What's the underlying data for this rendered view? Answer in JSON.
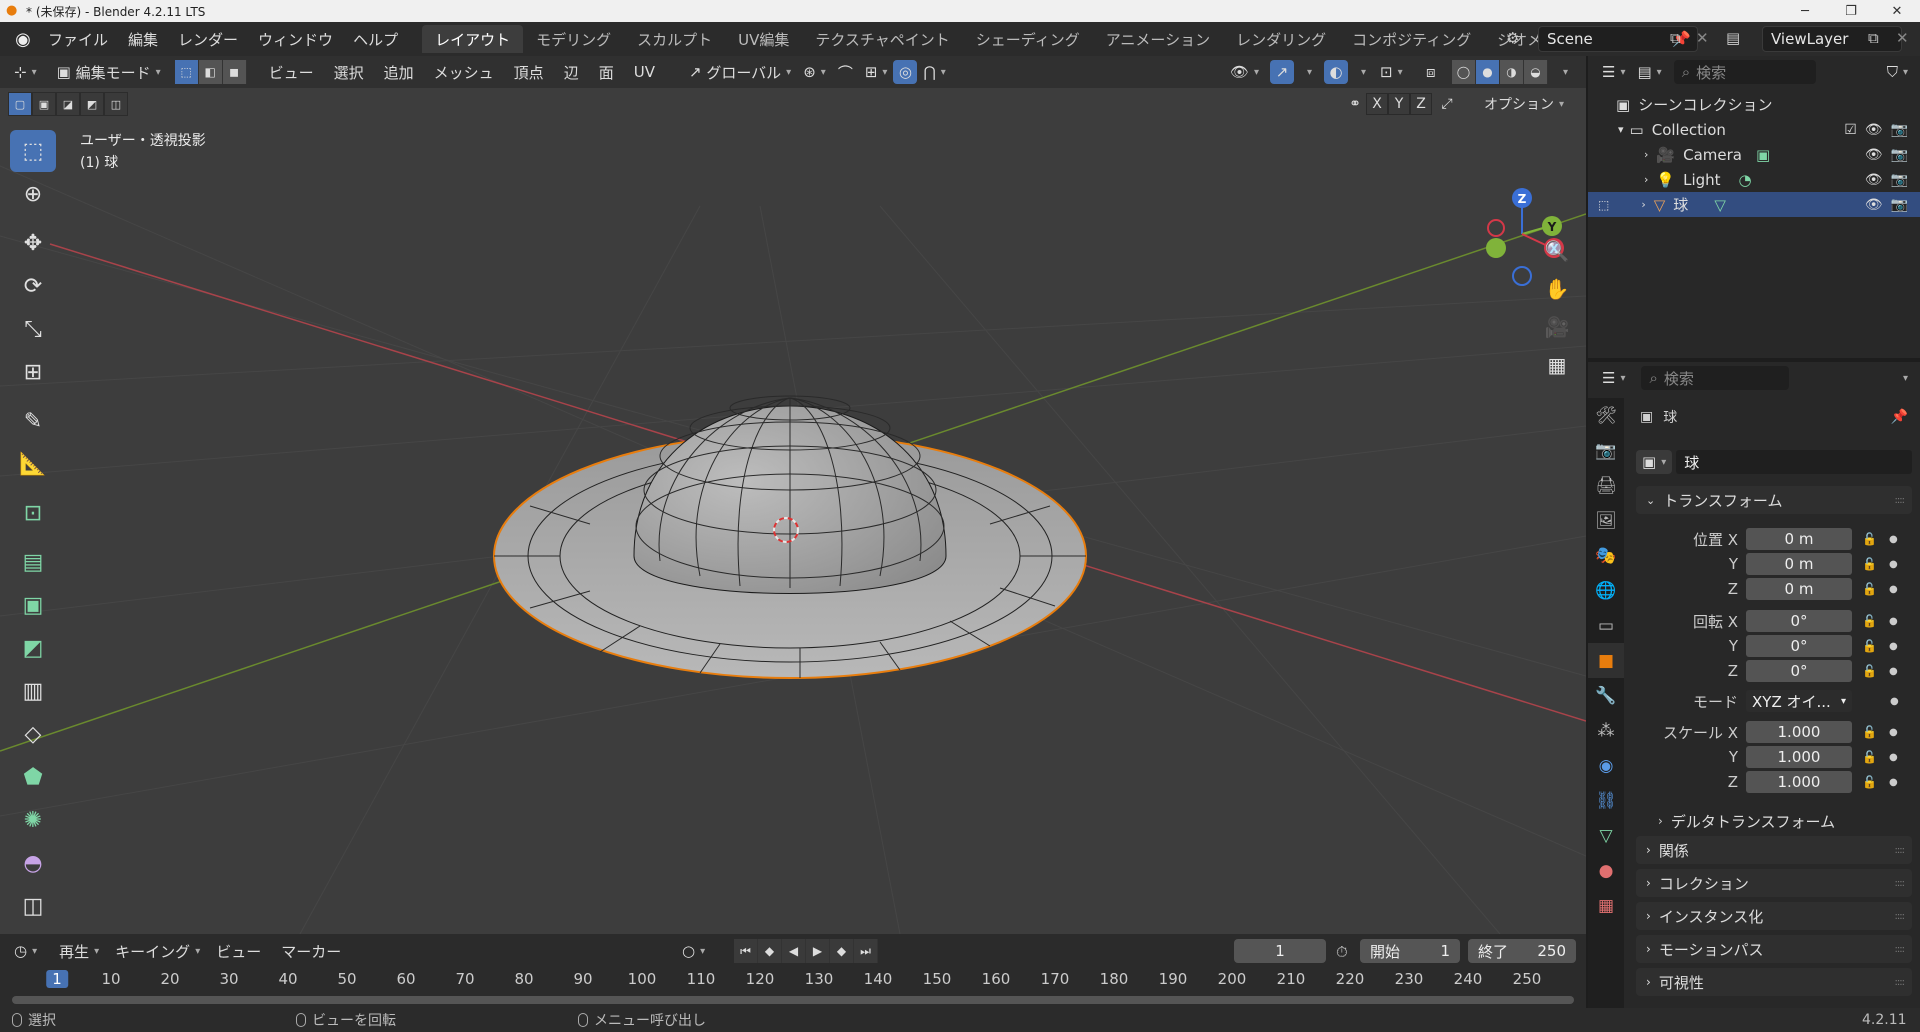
{
  "window": {
    "title": "* (未保存) - Blender 4.2.11 LTS"
  },
  "menu": [
    "ファイル",
    "編集",
    "レンダー",
    "ウィンドウ",
    "ヘルプ"
  ],
  "workspaces": [
    "レイアウト",
    "モデリング",
    "スカルプト",
    "UV編集",
    "テクスチャペイント",
    "シェーディング",
    "アニメーション",
    "レンダリング",
    "コンポジティング",
    "ジオメトリ"
  ],
  "scene": {
    "name": "Scene",
    "view_layer": "ViewLayer"
  },
  "viewport": {
    "mode": "編集モード",
    "menus": [
      "ビュー",
      "選択",
      "追加",
      "メッシュ",
      "頂点",
      "辺",
      "面",
      "UV"
    ],
    "transform_orientation": "グローバル",
    "overlay_title": "ユーザー・透視投影",
    "overlay_object": "(1) 球",
    "options_label": "オプション",
    "axis_x": "X",
    "axis_y": "Y",
    "axis_z": "Z",
    "gizmo": {
      "x": "X",
      "y": "Y",
      "z": "Z"
    }
  },
  "timeline": {
    "playback": "再生",
    "keying": "キーイング",
    "view": "ビュー",
    "marker": "マーカー",
    "current_frame": "1",
    "start_label": "開始",
    "start": "1",
    "end_label": "終了",
    "end": "250",
    "ticks": [
      "1",
      "10",
      "20",
      "30",
      "40",
      "50",
      "60",
      "70",
      "80",
      "90",
      "100",
      "110",
      "120",
      "130",
      "140",
      "150",
      "160",
      "170",
      "180",
      "190",
      "200",
      "210",
      "220",
      "230",
      "240",
      "250"
    ]
  },
  "statusbar": {
    "select": "選択",
    "rotate_view": "ビューを回転",
    "call_menu": "メニュー呼び出し",
    "version": "4.2.11"
  },
  "outliner": {
    "search_placeholder": "検索",
    "scene_collection": "シーンコレクション",
    "collection": "Collection",
    "items": [
      "Camera",
      "Light",
      "球"
    ]
  },
  "properties": {
    "search_placeholder": "検索",
    "object_name": "球",
    "object_field": "球",
    "transform_title": "トランスフォーム",
    "location_label": "位置 X",
    "loc_x": "0 m",
    "loc_y": "0 m",
    "loc_z": "0 m",
    "rotation_label": "回転 X",
    "rot_x": "0°",
    "rot_y": "0°",
    "rot_z": "0°",
    "mode_label": "モード",
    "mode_value": "XYZ オイ...",
    "scale_label": "スケール X",
    "scale_x": "1.000",
    "scale_y": "1.000",
    "scale_z": "1.000",
    "y_label": "Y",
    "z_label": "Z",
    "delta_transform": "デルタトランスフォーム",
    "panels": [
      "関係",
      "コレクション",
      "インスタンス化",
      "モーションパス",
      "可視性"
    ]
  },
  "colors": {
    "accent": "#4772b3",
    "selected_edge": "#e87d0d",
    "axis_x": "#c8424c",
    "axis_y": "#6a9a2e"
  }
}
